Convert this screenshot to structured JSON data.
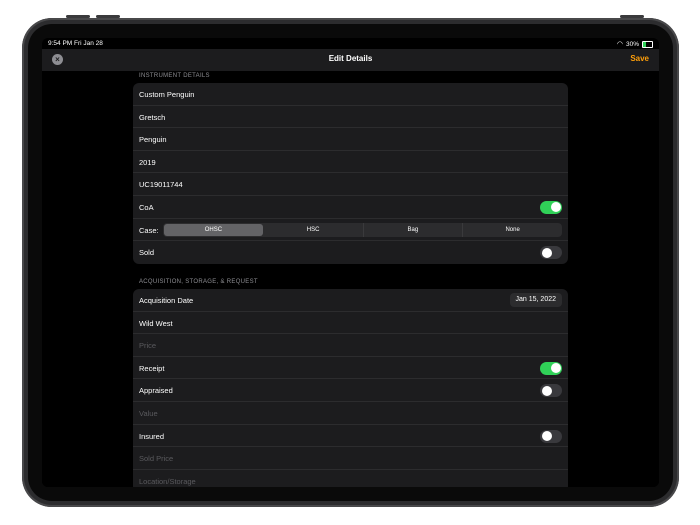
{
  "status": {
    "time": "9:54 PM  Fri Jan 28",
    "battery": "30%"
  },
  "nav": {
    "title": "Edit Details",
    "save": "Save"
  },
  "instrument": {
    "header": "INSTRUMENT DETAILS",
    "model": "Custom Penguin",
    "brand": "Gretsch",
    "name": "Penguin",
    "year": "2019",
    "serial": "UC19011744",
    "coa_label": "CoA",
    "coa_on": true,
    "case_label": "Case:",
    "case_options": [
      "OHSC",
      "HSC",
      "Bag",
      "None"
    ],
    "case_selected": "OHSC",
    "sold_label": "Sold",
    "sold_on": false
  },
  "acquisition": {
    "header": "ACQUISITION, STORAGE, & REQUEST",
    "date_label": "Acquisition Date",
    "date_value": "Jan 15, 2022",
    "source": "Wild West",
    "price_placeholder": "Price",
    "receipt_label": "Receipt",
    "receipt_on": true,
    "appraised_label": "Appraised",
    "appraised_on": false,
    "value_placeholder": "Value",
    "insured_label": "Insured",
    "insured_on": false,
    "sold_price_placeholder": "Sold Price",
    "location_placeholder": "Location/Storage"
  },
  "colors": {
    "accent": "#ff9f0a",
    "toggle_on": "#30d158",
    "background": "#000000",
    "cell": "#1c1c1e"
  }
}
